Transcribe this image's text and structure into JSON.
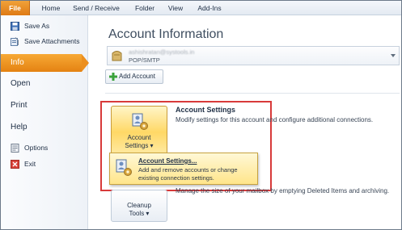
{
  "ribbon": {
    "tabs": [
      "File",
      "Home",
      "Send / Receive",
      "Folder",
      "View",
      "Add-Ins"
    ]
  },
  "nav": {
    "save_as": "Save As",
    "save_attachments": "Save Attachments",
    "info": "Info",
    "open": "Open",
    "print": "Print",
    "help": "Help",
    "options": "Options",
    "exit": "Exit"
  },
  "main": {
    "heading": "Account Information",
    "account": {
      "email": "ashishratan@systools.in",
      "type": "POP/SMTP"
    },
    "add_account": "Add Account",
    "account_settings": {
      "button_line1": "Account",
      "button_line2": "Settings ▾",
      "title": "Account Settings",
      "description": "Modify settings for this account and configure additional connections."
    },
    "popup": {
      "title": "Account Settings...",
      "description": "Add and remove accounts or change existing connection settings."
    },
    "cleanup": {
      "button_line1": "Cleanup",
      "button_line2": "Tools ▾",
      "description": "Manage the size of your mailbox by emptying Deleted Items and archiving."
    }
  },
  "colors": {
    "file_tab": "#df7a14",
    "selected_nav": "#e48212",
    "highlight": "#d83a3a",
    "hover_button": "#ffd866"
  }
}
